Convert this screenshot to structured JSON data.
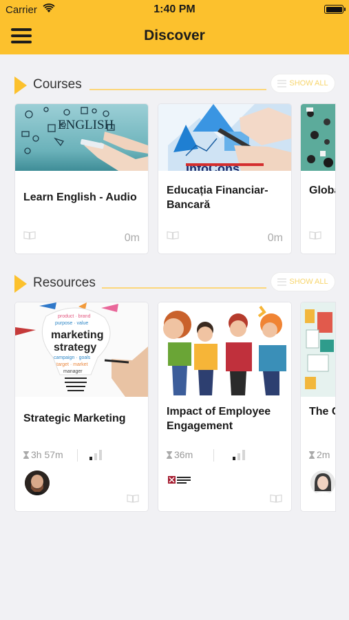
{
  "status_bar": {
    "carrier": "Carrier",
    "time": "1:40 PM"
  },
  "header": {
    "title": "Discover"
  },
  "courses": {
    "title": "Courses",
    "show_all": "SHOW ALL",
    "items": [
      {
        "title": "Learn English - Audio",
        "duration": "0m"
      },
      {
        "title": "Educația Financiar-Bancară",
        "duration": "0m"
      },
      {
        "title": "Globa Entre"
      }
    ]
  },
  "resources": {
    "title": "Resources",
    "show_all": "SHOW ALL",
    "items": [
      {
        "title": "Strategic Marketing",
        "duration": "3h 57m",
        "level": 1,
        "level_max": 3
      },
      {
        "title": "Impact of Employee Engagement",
        "duration": "36m",
        "level": 1,
        "level_max": 3,
        "author_logo": "Harvard Business Review"
      },
      {
        "title": "The C Crisis",
        "duration": "2m"
      }
    ]
  },
  "colors": {
    "accent": "#fcc12d",
    "background": "#f1f1f4",
    "card": "#ffffff"
  }
}
